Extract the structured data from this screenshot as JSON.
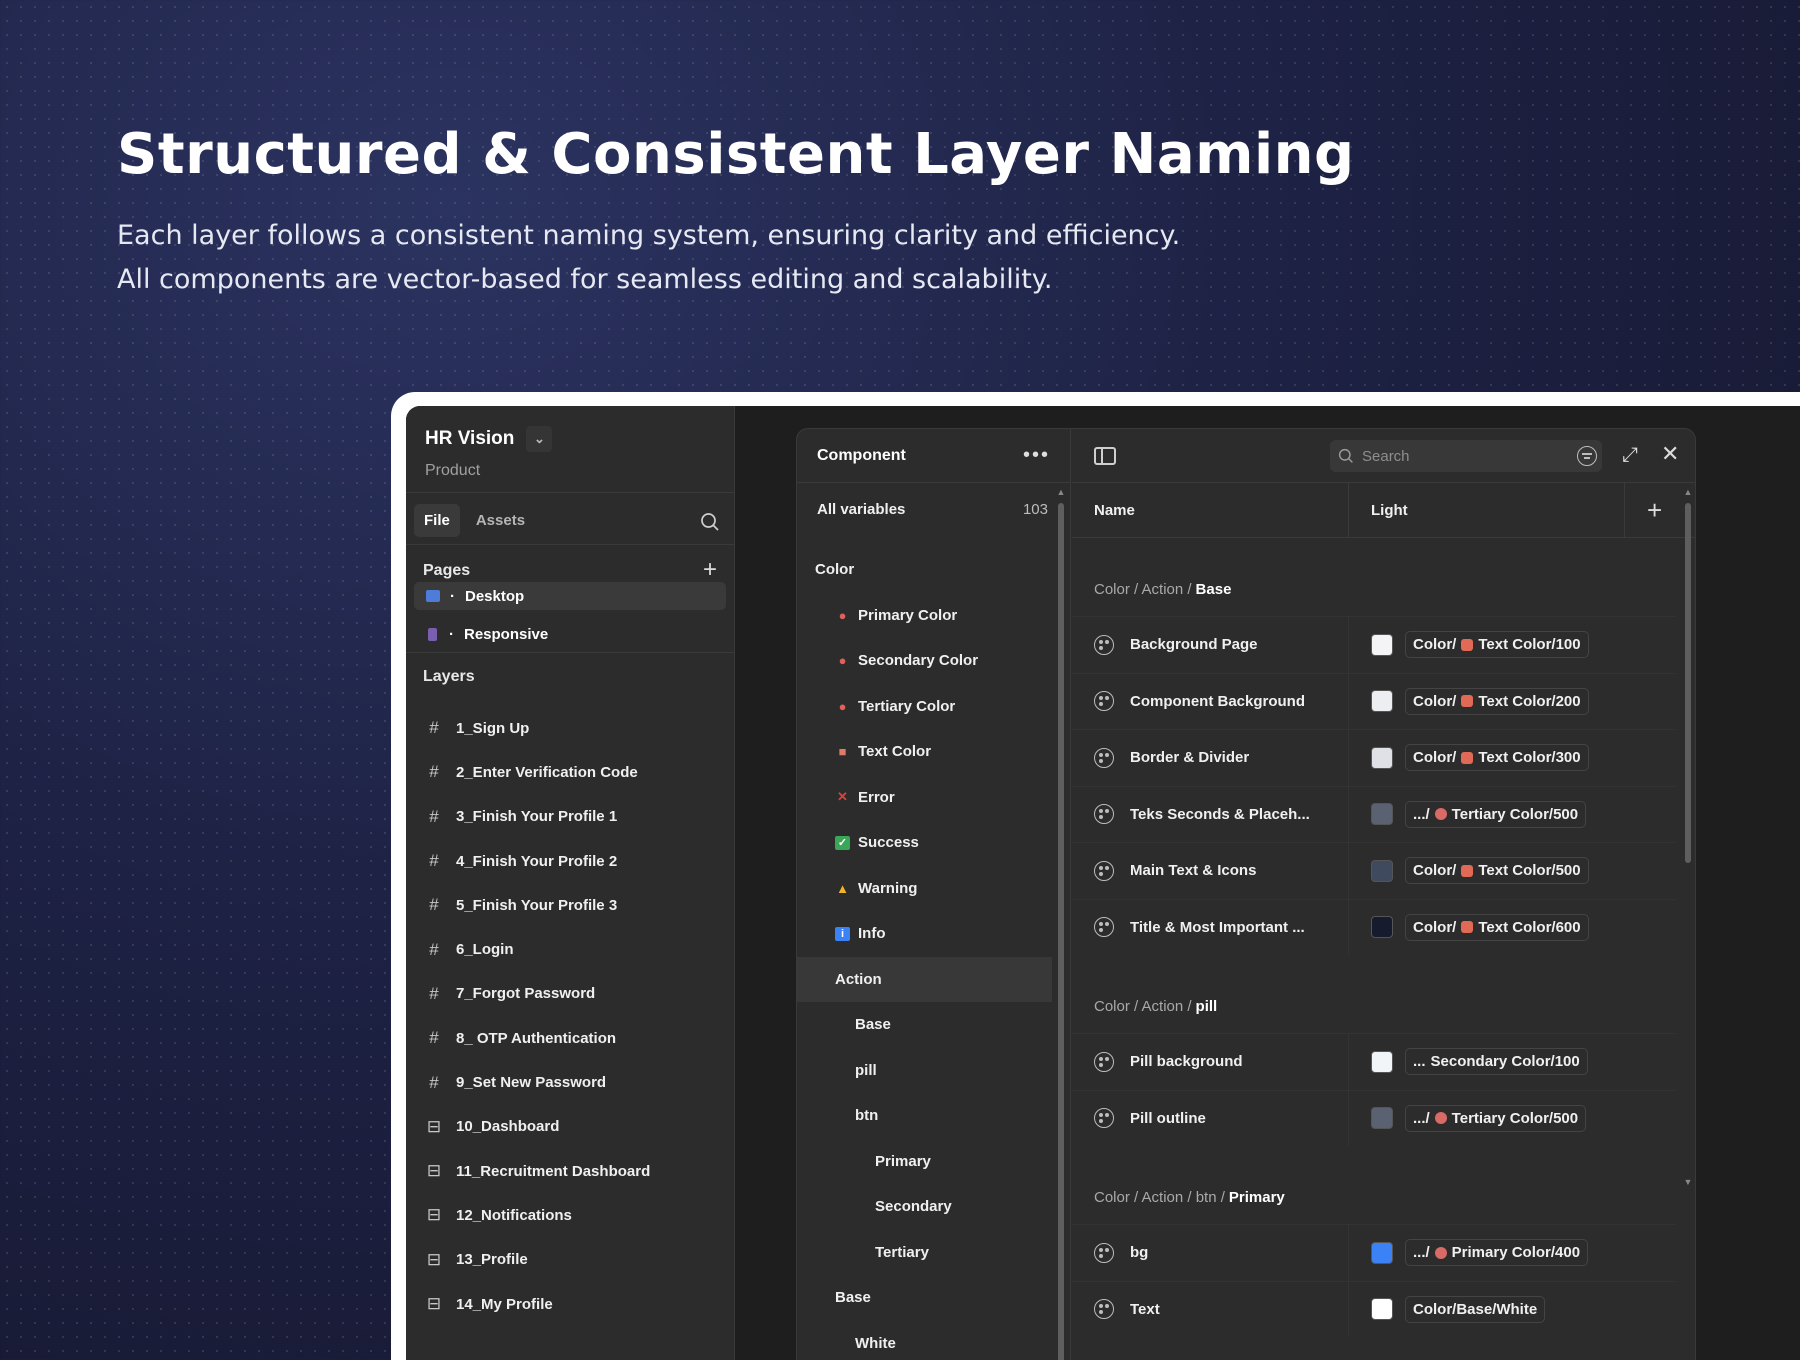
{
  "hero": {
    "headline": "Structured & Consistent Layer Naming",
    "line1": "Each layer follows a consistent naming system, ensuring clarity and efficiency.",
    "line2": "All components are vector-based for seamless editing and scalability."
  },
  "project": {
    "name": "HR Vision",
    "subtitle": "Product"
  },
  "tabs": {
    "file": "File",
    "assets": "Assets"
  },
  "pages": {
    "title": "Pages",
    "items": [
      {
        "label": "Desktop",
        "icon": "desktop-icon",
        "color": "#4f7cd9"
      },
      {
        "label": "Responsive",
        "icon": "mobile-icon",
        "color": "#7a5fb0"
      }
    ]
  },
  "layers": {
    "title": "Layers",
    "items": [
      {
        "label": "1_Sign Up",
        "icon": "frame-icon"
      },
      {
        "label": "2_Enter Verification Code",
        "icon": "frame-icon"
      },
      {
        "label": "3_Finish Your Profile 1",
        "icon": "frame-icon"
      },
      {
        "label": "4_Finish Your Profile 2",
        "icon": "frame-icon"
      },
      {
        "label": "5_Finish Your Profile 3",
        "icon": "frame-icon"
      },
      {
        "label": "6_Login",
        "icon": "frame-icon"
      },
      {
        "label": "7_Forgot Password",
        "icon": "frame-icon"
      },
      {
        "label": "8_ OTP Authentication",
        "icon": "frame-icon"
      },
      {
        "label": "9_Set New Password",
        "icon": "frame-icon"
      },
      {
        "label": "10_Dashboard",
        "icon": "layout-icon"
      },
      {
        "label": "11_Recruitment Dashboard",
        "icon": "layout-icon"
      },
      {
        "label": "12_Notifications",
        "icon": "layout-icon"
      },
      {
        "label": "13_Profile",
        "icon": "layout-icon"
      },
      {
        "label": "14_My Profile",
        "icon": "layout-icon"
      }
    ]
  },
  "variables": {
    "collection": "Component",
    "all_label": "All variables",
    "all_count": "103",
    "tree": [
      {
        "label": "Color",
        "indent": 0,
        "icon": ""
      },
      {
        "label": "Primary Color",
        "indent": 1,
        "icon": "palette-icon",
        "glyph": "●",
        "color": "#e0605a"
      },
      {
        "label": "Secondary Color",
        "indent": 1,
        "icon": "palette-icon",
        "glyph": "●",
        "color": "#e0605a"
      },
      {
        "label": "Tertiary Color",
        "indent": 1,
        "icon": "palette-icon",
        "glyph": "●",
        "color": "#e0605a"
      },
      {
        "label": "Text Color",
        "indent": 1,
        "icon": "document-icon",
        "glyph": "■",
        "color": "#e07a66"
      },
      {
        "label": "Error",
        "indent": 1,
        "icon": "cross-icon",
        "glyph": "✕",
        "color": "#e0403a"
      },
      {
        "label": "Success",
        "indent": 1,
        "icon": "check-icon",
        "glyph": "✓",
        "color": "#3aa657"
      },
      {
        "label": "Warning",
        "indent": 1,
        "icon": "warning-icon",
        "glyph": "▲",
        "color": "#f0b429"
      },
      {
        "label": "Info",
        "indent": 1,
        "icon": "info-icon",
        "glyph": "i",
        "color": "#3b82f6"
      },
      {
        "label": "Action",
        "indent": 1,
        "icon": "",
        "selected": true
      },
      {
        "label": "Base",
        "indent": 2,
        "icon": ""
      },
      {
        "label": "pill",
        "indent": 2,
        "icon": ""
      },
      {
        "label": "btn",
        "indent": 2,
        "icon": ""
      },
      {
        "label": "Primary",
        "indent": 3,
        "icon": ""
      },
      {
        "label": "Secondary",
        "indent": 3,
        "icon": ""
      },
      {
        "label": "Tertiary",
        "indent": 3,
        "icon": ""
      },
      {
        "label": "Base",
        "indent": 1,
        "icon": ""
      },
      {
        "label": "White",
        "indent": 2,
        "icon": ""
      }
    ],
    "search_placeholder": "Search",
    "col_name": "Name",
    "col_mode": "Light",
    "groups": [
      {
        "prefix": "Color / Action / ",
        "leaf": "Base",
        "rows": [
          {
            "name": "Background Page",
            "swatch": "#f4f4f6",
            "alias": "Color/ ",
            "token": "Text Color/100",
            "token_icon": "document-icon"
          },
          {
            "name": "Component Background",
            "swatch": "#eceef1",
            "alias": "Color/ ",
            "token": "Text Color/200",
            "token_icon": "document-icon"
          },
          {
            "name": "Border & Divider",
            "swatch": "#dfe1e6",
            "alias": "Color/ ",
            "token": "Text Color/300",
            "token_icon": "document-icon"
          },
          {
            "name": "Teks Seconds & Placeh...",
            "swatch": "#5a6272",
            "alias": ".../ ",
            "token": "Tertiary Color/500",
            "token_icon": "palette-icon"
          },
          {
            "name": "Main Text & Icons",
            "swatch": "#3f4a5f",
            "alias": "Color/ ",
            "token": "Text Color/500",
            "token_icon": "document-icon"
          },
          {
            "name": "Title & Most Important ...",
            "swatch": "#161c2e",
            "alias": "Color/ ",
            "token": "Text Color/600",
            "token_icon": "document-icon"
          }
        ]
      },
      {
        "prefix": "Color / Action / ",
        "leaf": "pill",
        "rows": [
          {
            "name": "Pill background",
            "swatch": "#f2f5f8",
            "alias": "... ",
            "token": "Secondary Color/100",
            "token_icon": ""
          },
          {
            "name": "Pill outline",
            "swatch": "#5a6272",
            "alias": ".../ ",
            "token": "Tertiary Color/500",
            "token_icon": "palette-icon"
          }
        ]
      },
      {
        "prefix": "Color / Action / btn / ",
        "leaf": "Primary",
        "rows": [
          {
            "name": "bg",
            "swatch": "#3b82f6",
            "alias": ".../ ",
            "token": "Primary Color/400",
            "token_icon": "palette-icon"
          },
          {
            "name": "Text",
            "swatch": "#ffffff",
            "alias": "",
            "token": "Color/Base/White",
            "token_icon": ""
          }
        ]
      }
    ]
  }
}
